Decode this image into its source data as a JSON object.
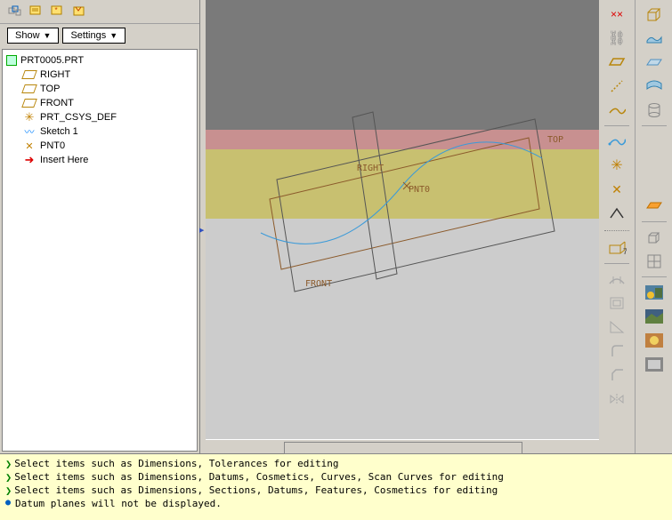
{
  "toolbar": {
    "show_label": "Show",
    "settings_label": "Settings"
  },
  "tree": {
    "root": "PRT0005.PRT",
    "items": [
      {
        "label": "RIGHT",
        "icon": "datum-plane"
      },
      {
        "label": "TOP",
        "icon": "datum-plane"
      },
      {
        "label": "FRONT",
        "icon": "datum-plane"
      },
      {
        "label": "PRT_CSYS_DEF",
        "icon": "csys"
      },
      {
        "label": "Sketch 1",
        "icon": "sketch"
      },
      {
        "label": "PNT0",
        "icon": "pnt"
      },
      {
        "label": "Insert Here",
        "icon": "insert"
      }
    ]
  },
  "viewport": {
    "labels": {
      "top": "TOP",
      "right": "RIGHT",
      "front": "FRONT",
      "pnt0": "PNT0"
    }
  },
  "status": {
    "lines": [
      "Select items such as Dimensions, Tolerances for editing",
      "Select items such as Dimensions, Datums, Cosmetics, Curves, Scan Curves for editing",
      "Select items such as Dimensions, Sections, Datums, Features, Cosmetics for editing"
    ],
    "bullet_line": "Datum planes will not be displayed."
  },
  "colors": {
    "datum": "#8b5a2b",
    "sketch": "#3a9ad9"
  }
}
